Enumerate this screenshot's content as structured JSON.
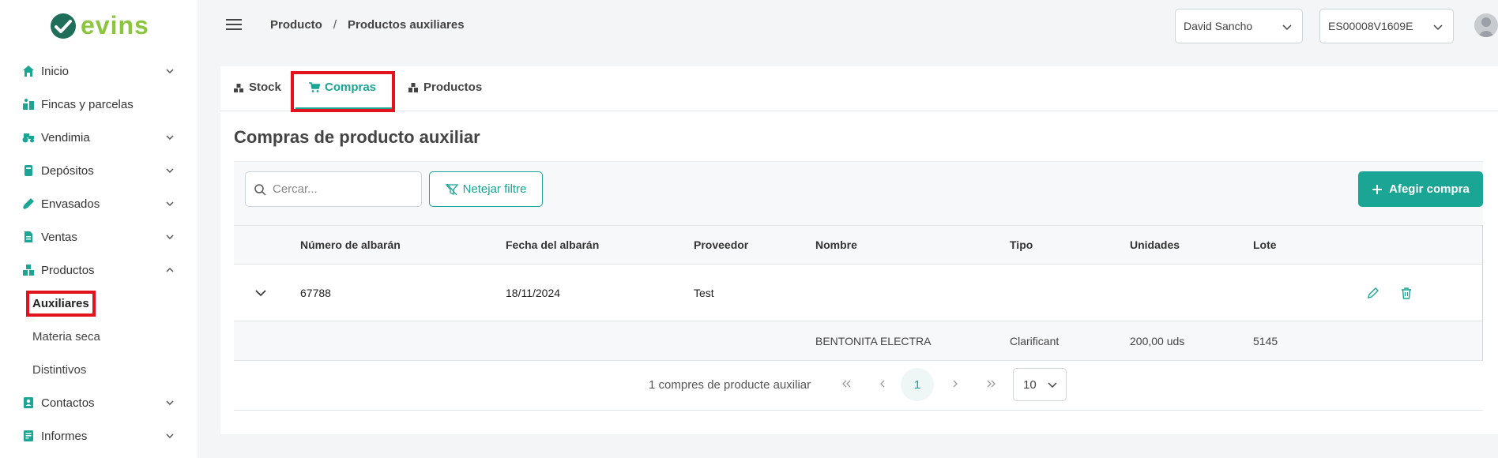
{
  "brand": {
    "name": "evins",
    "accent": "#1aa595",
    "logo_green": "#8cc63f"
  },
  "sidebar": {
    "items": [
      {
        "label": "Inicio",
        "icon": "home-icon",
        "expandable": true
      },
      {
        "label": "Fincas y parcelas",
        "icon": "parcels-icon",
        "expandable": false
      },
      {
        "label": "Vendimia",
        "icon": "tractor-icon",
        "expandable": true
      },
      {
        "label": "Depósitos",
        "icon": "tank-icon",
        "expandable": true
      },
      {
        "label": "Envasados",
        "icon": "bottle-icon",
        "expandable": true
      },
      {
        "label": "Ventas",
        "icon": "invoice-icon",
        "expandable": true
      },
      {
        "label": "Productos",
        "icon": "boxes-icon",
        "expandable": true,
        "expanded": true
      },
      {
        "label": "Contactos",
        "icon": "contact-icon",
        "expandable": true
      },
      {
        "label": "Informes",
        "icon": "report-icon",
        "expandable": true
      }
    ],
    "productos_sub": [
      {
        "label": "Auxiliares",
        "active": true
      },
      {
        "label": "Materia seca",
        "active": false
      },
      {
        "label": "Distintivos",
        "active": false
      }
    ]
  },
  "header": {
    "breadcrumb": [
      "Producto",
      "Productos auxiliares"
    ],
    "breadcrumb_sep": "/",
    "user": "David Sancho",
    "code": "ES00008V1609E"
  },
  "tabs": [
    {
      "label": "Stock",
      "icon": "stock-icon",
      "active": false
    },
    {
      "label": "Compras",
      "icon": "cart-icon",
      "active": true
    },
    {
      "label": "Productos",
      "icon": "boxes-icon",
      "active": false
    }
  ],
  "main": {
    "title": "Compras de producto auxiliar",
    "search_placeholder": "Cercar...",
    "clear_filter_label": "Netejar filtre",
    "add_label": "Afegir compra"
  },
  "table": {
    "columns": [
      "Número de albarán",
      "Fecha del albarán",
      "Proveedor",
      "Nombre",
      "Tipo",
      "Unidades",
      "Lote"
    ],
    "rows": [
      {
        "albaran": "67788",
        "fecha": "18/11/2024",
        "proveedor": "Test",
        "lines": [
          {
            "nombre": "BENTONITA ELECTRA",
            "tipo": "Clarificant",
            "unidades": "200,00 uds",
            "lote": "5145"
          }
        ]
      }
    ]
  },
  "pagination": {
    "info": "1 compres de producte auxiliar",
    "current_page": "1",
    "page_size": "10"
  }
}
